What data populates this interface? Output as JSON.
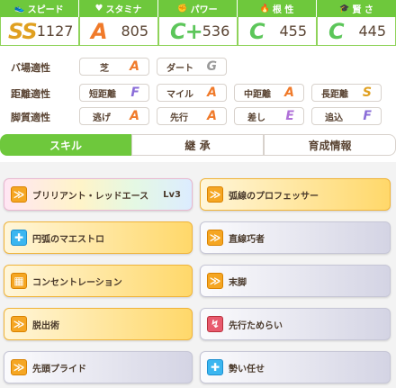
{
  "stats": [
    {
      "label": "スピード",
      "icon": "shoe-icon",
      "glyph": "👟",
      "grade": "SS",
      "value": "1127",
      "color": "#e0a020"
    },
    {
      "label": "スタミナ",
      "icon": "heart-icon",
      "glyph": "♥",
      "grade": "A",
      "value": "805",
      "color": "#f07a2a"
    },
    {
      "label": "パワー",
      "icon": "muscle-icon",
      "glyph": "✊",
      "grade": "C+",
      "value": "536",
      "color": "#5cc65a"
    },
    {
      "label": "根 性",
      "icon": "flame-icon",
      "glyph": "🔥",
      "grade": "C",
      "value": "455",
      "color": "#5cc65a"
    },
    {
      "label": "賢 さ",
      "icon": "graduation-cap-icon",
      "glyph": "🎓",
      "grade": "C",
      "value": "445",
      "color": "#5cc65a"
    }
  ],
  "aptitude": {
    "track": {
      "label": "バ場適性",
      "items": [
        {
          "name": "芝",
          "grade": "A"
        },
        {
          "name": "ダート",
          "grade": "G"
        }
      ]
    },
    "distance": {
      "label": "距離適性",
      "items": [
        {
          "name": "短距離",
          "grade": "F"
        },
        {
          "name": "マイル",
          "grade": "A"
        },
        {
          "name": "中距離",
          "grade": "A"
        },
        {
          "name": "長距離",
          "grade": "S"
        }
      ]
    },
    "style": {
      "label": "脚質適性",
      "items": [
        {
          "name": "逃げ",
          "grade": "A"
        },
        {
          "name": "先行",
          "grade": "A"
        },
        {
          "name": "差し",
          "grade": "E"
        },
        {
          "name": "追込",
          "grade": "F"
        }
      ]
    }
  },
  "grade_colors": {
    "SS": "#e0a020",
    "S": "#e0a020",
    "A": "#f07a2a",
    "B": "#ee6aa0",
    "C": "#5cc65a",
    "C+": "#5cc65a",
    "E": "#b070d8",
    "F": "#8a6cd8",
    "G": "#9a9a9a"
  },
  "tabs": [
    {
      "label": "スキル"
    },
    {
      "label": "継 承"
    },
    {
      "label": "育成情報"
    }
  ],
  "skills": [
    {
      "name": "ブリリアント・レッドエース",
      "level": "Lv3",
      "style": "rainbow",
      "icon": "speed-up-icon",
      "glyph": "≫"
    },
    {
      "name": "弧線のプロフェッサー",
      "level": "",
      "style": "gold",
      "icon": "speed-up-icon",
      "glyph": "≫"
    },
    {
      "name": "円弧のマエストロ",
      "level": "",
      "style": "gold",
      "icon": "stamina-recovery-icon",
      "glyph": "✚"
    },
    {
      "name": "直線巧者",
      "level": "",
      "style": "normal",
      "icon": "speed-up-icon",
      "glyph": "≫"
    },
    {
      "name": "コンセントレーション",
      "level": "",
      "style": "gold",
      "icon": "gate-icon",
      "glyph": "▦"
    },
    {
      "name": "末脚",
      "level": "",
      "style": "normal",
      "icon": "speed-up-icon",
      "glyph": "≫"
    },
    {
      "name": "脱出術",
      "level": "",
      "style": "gold",
      "icon": "speed-up-icon",
      "glyph": "≫"
    },
    {
      "name": "先行ためらい",
      "level": "",
      "style": "normal",
      "icon": "debuff-icon",
      "glyph": "↯"
    },
    {
      "name": "先頭プライド",
      "level": "",
      "style": "normal",
      "icon": "speed-up-icon",
      "glyph": "≫"
    },
    {
      "name": "勢い任せ",
      "level": "",
      "style": "normal",
      "icon": "stamina-recovery-icon",
      "glyph": "✚"
    }
  ]
}
